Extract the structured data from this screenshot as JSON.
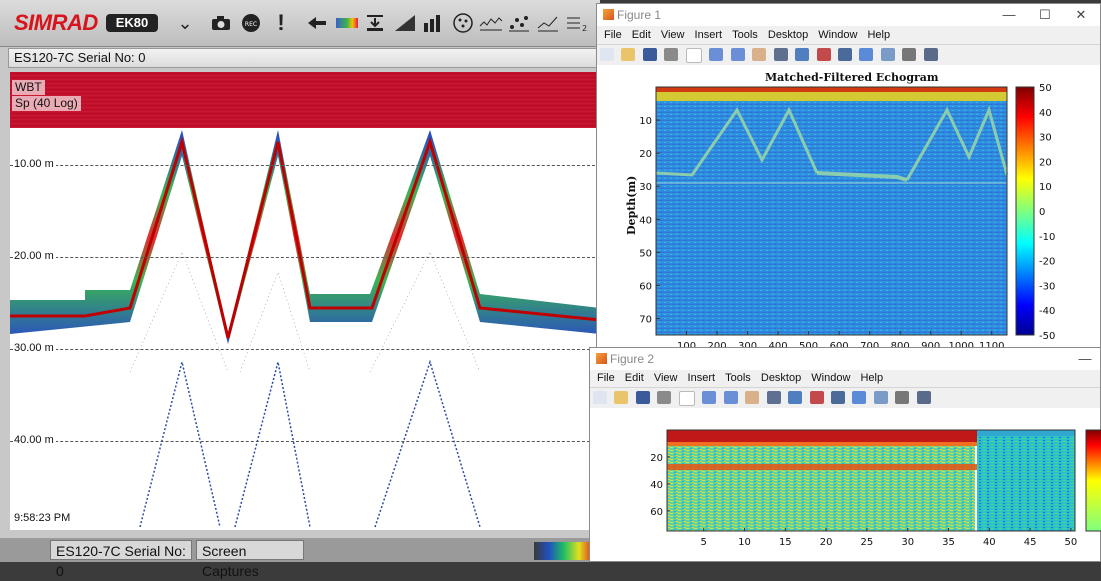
{
  "ek80": {
    "brand": "SIMRAD",
    "model": "EK80",
    "channel_bar": "ES120-7C Serial No: 0",
    "toolbar_icons": [
      "chevrons-down-icon",
      "camera-icon",
      "record-icon",
      "exclamation-icon",
      "back-arrow-icon",
      "color-scale-icon",
      "bottom-detect-icon",
      "gradient-icon",
      "bar-chart-icon",
      "target-icon",
      "line-noise-icon",
      "scatter-icon",
      "trend-icon",
      "numbered-list-icon"
    ],
    "echo_tag_1": "WBT",
    "echo_tag_2": "Sp (40 Log)",
    "depth_labels": [
      "10.00 m",
      "20.00 m",
      "30.00 m",
      "40.00 m"
    ],
    "time": "9:58:23 PM",
    "status_tabs": [
      "ES120-7C Serial No: 0",
      "Screen Captures"
    ]
  },
  "figure1": {
    "window_title": "Figure 1",
    "menu": [
      "File",
      "Edit",
      "View",
      "Insert",
      "Tools",
      "Desktop",
      "Window",
      "Help"
    ],
    "chart_data": {
      "type": "heatmap",
      "title": "Matched-Filtered Echogram",
      "xlabel": "",
      "ylabel": "Depth(m)",
      "xlim": [
        0,
        1150
      ],
      "ylim": [
        75,
        0
      ],
      "xticks": [
        100,
        200,
        300,
        400,
        500,
        600,
        700,
        800,
        900,
        1000,
        1100
      ],
      "yticks": [
        10,
        20,
        30,
        40,
        50,
        60,
        70
      ],
      "colorbar_ticks": [
        50,
        40,
        30,
        20,
        10,
        0,
        -10,
        -20,
        -30,
        -40,
        -50
      ],
      "clim": [
        -50,
        50
      ]
    }
  },
  "figure2": {
    "window_title": "Figure 2",
    "menu": [
      "File",
      "Edit",
      "View",
      "Insert",
      "Tools",
      "Desktop",
      "Window",
      "Help"
    ],
    "chart_data": {
      "type": "heatmap",
      "title": "",
      "xlabel": "",
      "ylabel": "",
      "xlim": [
        0.5,
        50.5
      ],
      "ylim": [
        75,
        0
      ],
      "xticks": [
        5,
        10,
        15,
        20,
        25,
        30,
        35,
        40,
        45,
        50
      ],
      "yticks": [
        20,
        40,
        60
      ]
    }
  },
  "colors": {
    "brand_red": "#d7141c",
    "jet_low": "#00008f",
    "jet_high": "#800000"
  }
}
